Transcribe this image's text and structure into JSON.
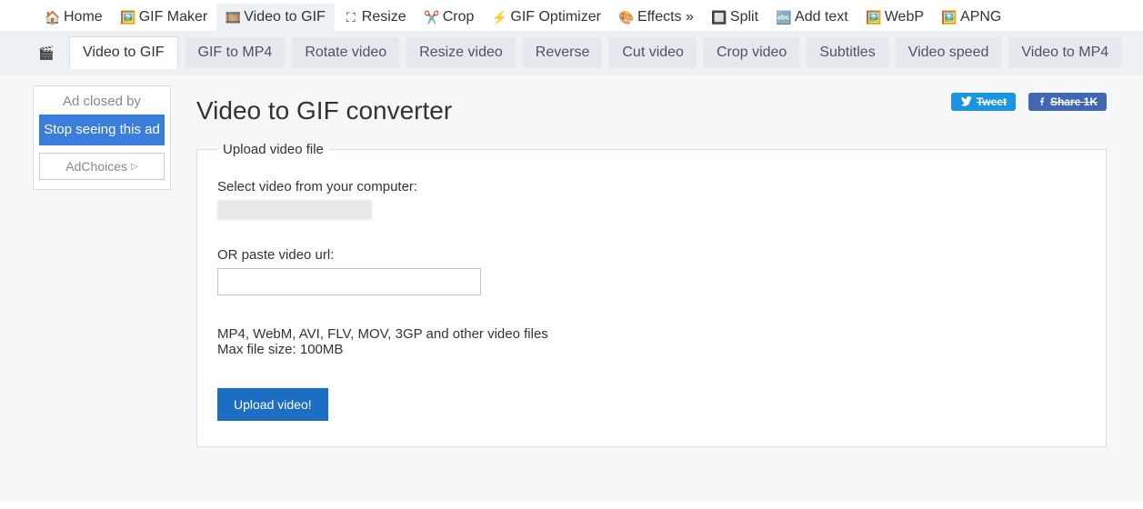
{
  "topnav": [
    {
      "label": "Home",
      "icon": "home"
    },
    {
      "label": "GIF Maker",
      "icon": "gif"
    },
    {
      "label": "Video to GIF",
      "icon": "video",
      "active": true
    },
    {
      "label": "Resize",
      "icon": "resize"
    },
    {
      "label": "Crop",
      "icon": "crop"
    },
    {
      "label": "GIF Optimizer",
      "icon": "optimize"
    },
    {
      "label": "Effects »",
      "icon": "effects"
    },
    {
      "label": "Split",
      "icon": "split"
    },
    {
      "label": "Add text",
      "icon": "text"
    },
    {
      "label": "WebP",
      "icon": "webp"
    },
    {
      "label": "APNG",
      "icon": "apng"
    }
  ],
  "subnav": [
    {
      "label": "Video to GIF",
      "active": true
    },
    {
      "label": "GIF to MP4"
    },
    {
      "label": "Rotate video"
    },
    {
      "label": "Resize video"
    },
    {
      "label": "Reverse"
    },
    {
      "label": "Cut video"
    },
    {
      "label": "Crop video"
    },
    {
      "label": "Subtitles"
    },
    {
      "label": "Video speed"
    },
    {
      "label": "Video to MP4"
    }
  ],
  "ad": {
    "closed_by": "Ad closed by",
    "stop_seeing": "Stop seeing this ad",
    "adchoices": "AdChoices"
  },
  "page_title": "Video to GIF converter",
  "share": {
    "tweet": "Tweet",
    "fb_label": "Share",
    "fb_count": "1K"
  },
  "upload": {
    "legend": "Upload video file",
    "select_label": "Select video from your computer:",
    "or_label": "OR paste video url:",
    "url_value": "",
    "hint1": "MP4, WebM, AVI, FLV, MOV, 3GP and other video files",
    "hint2": "Max file size: 100MB",
    "button": "Upload video!"
  }
}
